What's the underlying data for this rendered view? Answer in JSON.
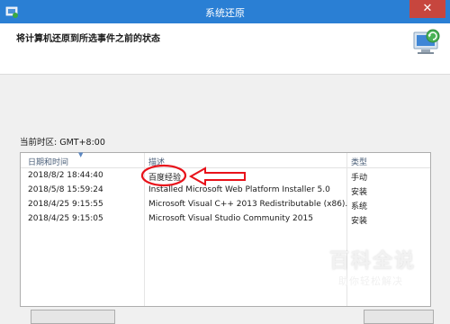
{
  "window": {
    "title": "系统还原",
    "close_glyph": "✕",
    "icon": "system-restore-icon"
  },
  "header": {
    "heading": "将计算机还原到所选事件之前的状态"
  },
  "timezone_label": "当前时区: GMT+8:00",
  "table": {
    "columns": [
      "日期和时间",
      "描述",
      "类型"
    ],
    "rows": [
      {
        "datetime": "2018/8/2 18:44:40",
        "description": "百度经验",
        "type": "手动"
      },
      {
        "datetime": "2018/5/8 15:59:24",
        "description": "Installed Microsoft Web Platform Installer 5.0",
        "type": "安装"
      },
      {
        "datetime": "2018/4/25 9:15:55",
        "description": "Microsoft Visual C++ 2013 Redistributable (x86)...",
        "type": "系统"
      },
      {
        "datetime": "2018/4/25 9:15:05",
        "description": "Microsoft Visual Studio Community 2015",
        "type": "安装"
      }
    ]
  },
  "watermark": {
    "main": "百科全说",
    "sub": "助你轻松解决"
  },
  "colors": {
    "titlebar": "#2a7fd4",
    "close": "#c7463e",
    "annotation": "#e8121a"
  }
}
